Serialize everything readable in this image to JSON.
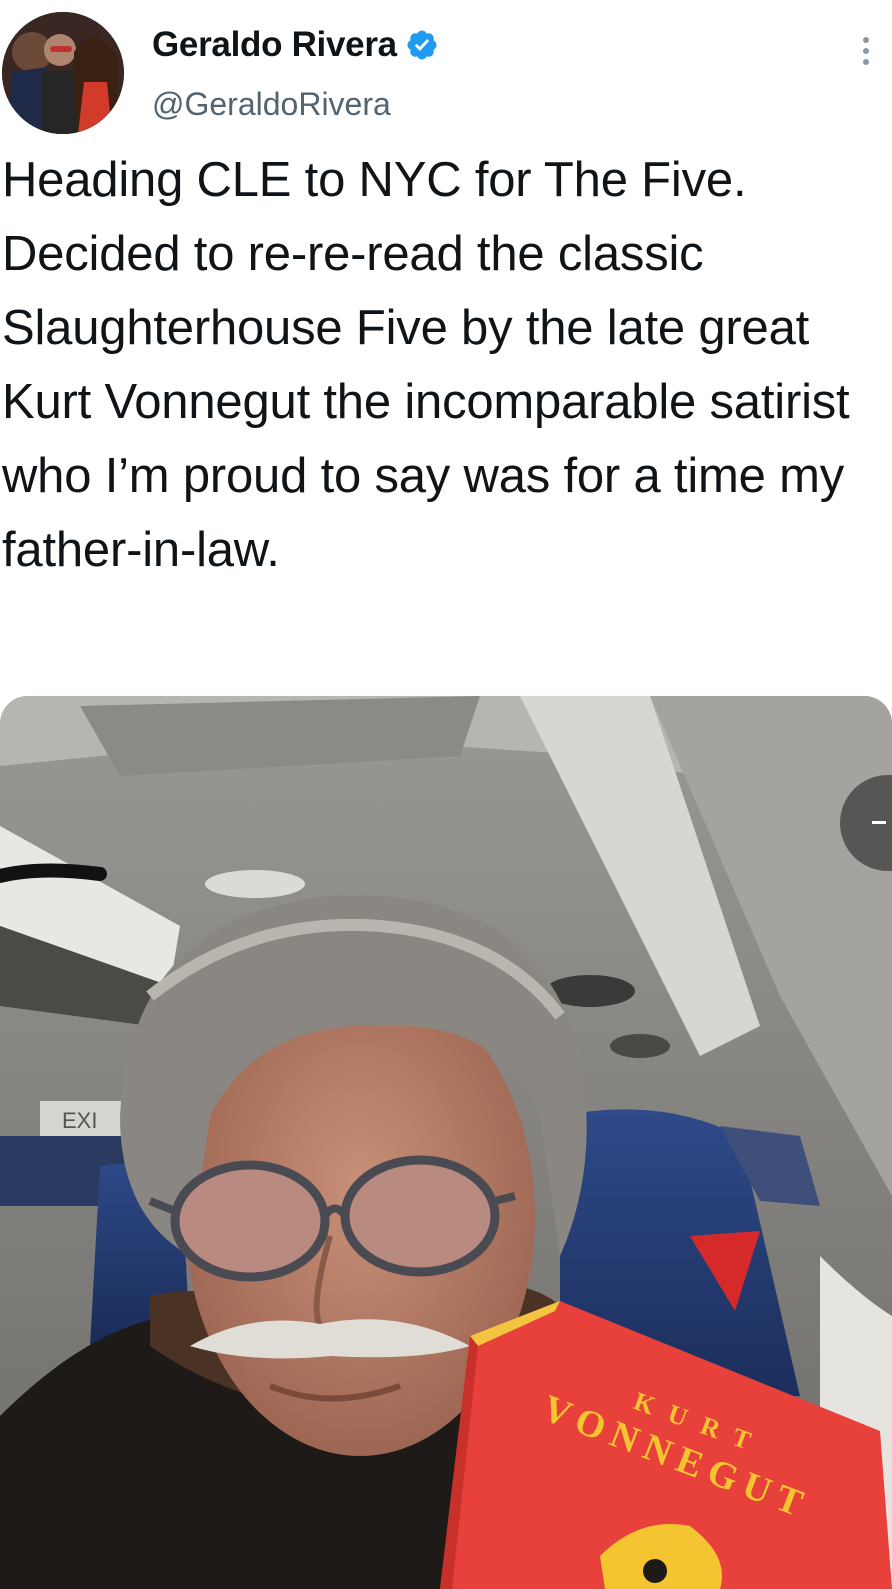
{
  "tweet": {
    "author": {
      "display_name": "Geraldo Rivera",
      "handle": "@GeraldoRivera",
      "verified": true
    },
    "text": "Heading CLE to NYC for The Five. Decided to re-re-read the classic Slaughterhouse Five by the late great Kurt Vonnegut the incomparable satirist who I’m proud to say was for a time my father-in-law.",
    "media": {
      "book_author_first": "KURT",
      "book_author_last": "VONNEGUT",
      "exit_sign": "EXI"
    }
  },
  "icons": {
    "verified": "verified-badge-icon",
    "more": "more-vertical-icon",
    "next": "next-media-icon"
  },
  "colors": {
    "verified_blue": "#1d9bf0",
    "text": "#0f1419",
    "handle": "#536471",
    "book_red": "#e8403a"
  }
}
